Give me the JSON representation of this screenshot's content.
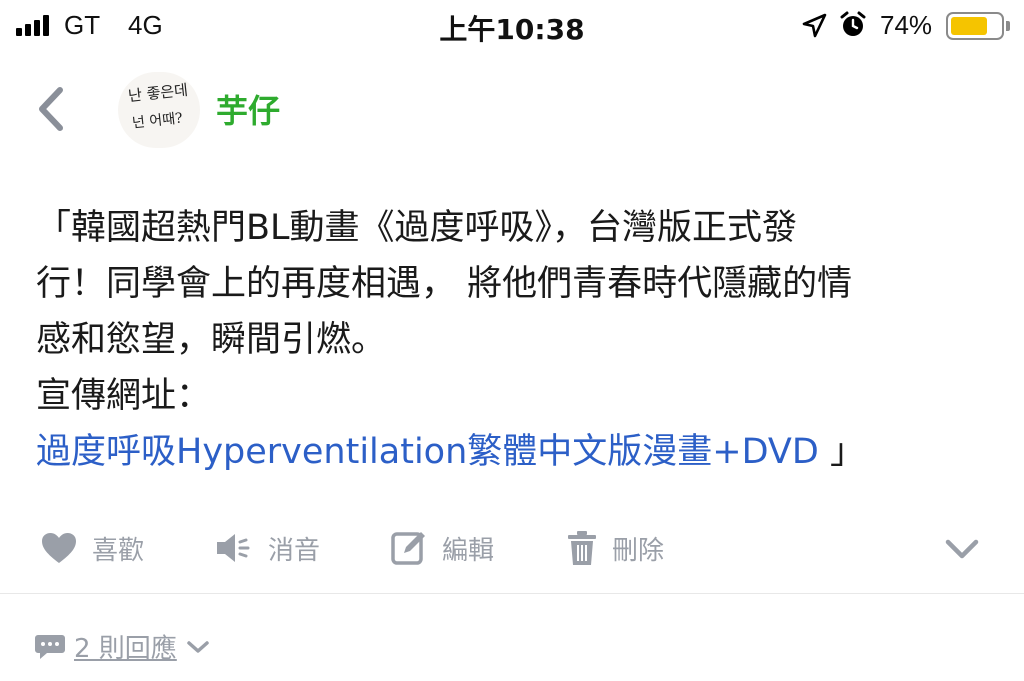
{
  "status_bar": {
    "carrier": "GT",
    "network": "4G",
    "time": "上午10:38",
    "battery_percent": "74%",
    "battery_level": 0.74,
    "battery_color": "#f5c400"
  },
  "header": {
    "avatar_text_line1": "난 좋은데",
    "avatar_text_line2": "넌 어때?",
    "username": "芋仔",
    "username_color": "#2eab2e"
  },
  "post": {
    "lines": [
      "「韓國超熱門BL動畫《過度呼吸》，台灣版正式發",
      "行！同學會上的再度相遇， 將他們青春時代隱藏的情",
      "感和慾望，瞬間引燃。",
      "宣傳網址："
    ],
    "link_text": "過度呼吸Hyperventilation繁體中文版漫畫+DVD",
    "closing_quote": " 」",
    "link_color": "#2c5fc7"
  },
  "actions": {
    "like": "喜歡",
    "mute": "消音",
    "edit": "編輯",
    "delete": "刪除",
    "more_icon": "chevron-down-icon"
  },
  "replies": {
    "label": "2 則回應",
    "icon": "comment-icon"
  }
}
